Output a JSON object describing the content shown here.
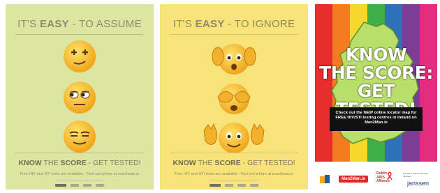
{
  "posters": [
    {
      "title_prefix": "IT'S",
      "title_bold": "EASY",
      "title_suffix": "- TO ASSUME",
      "emoji_icons": [
        "smirk-plus-eyes-emoji-icon",
        "side-eye-emoji-icon",
        "relieved-emoji-icon"
      ],
      "tagline_bold1": "KNOW",
      "tagline_mid": "THE",
      "tagline_bold2": "SCORE",
      "tagline_end": "- GET TESTED!",
      "info": "Free HIV and STI tests are available - Find out where at man2man.ie"
    },
    {
      "title_prefix": "IT'S",
      "title_bold": "EASY",
      "title_suffix": "- TO IGNORE",
      "emoji_icons": [
        "hear-no-evil-emoji-icon",
        "see-no-evil-emoji-icon",
        "speak-no-evil-emoji-icon"
      ],
      "tagline_bold1": "KNOW",
      "tagline_mid": "THE",
      "tagline_bold2": "SCORE",
      "tagline_end": "- GET TESTED!",
      "info": "Free HIV and STI tests are available - Find out where at man2man.ie"
    },
    {
      "headline": [
        "KNOW",
        "THE SCORE:",
        "GET TESTED!"
      ],
      "box_text": "Check out the NEW online locator map for FREE HIV/STI testing centres in Ireland on Man2Man.ie",
      "logos": {
        "man2man": "Man2Man.ie",
        "dublin_aids": "Dublin AIDS Alliance",
        "funded_by": "Funded in partnership with Janssen",
        "janssen": "janssen"
      }
    }
  ],
  "colors": {
    "poster1_bg": "#dde5a0",
    "poster2_bg": "#f8e27a",
    "rainbow": [
      "#e52d2d",
      "#f47c20",
      "#f6d82c",
      "#3dae49",
      "#2d71b8",
      "#7b3b96",
      "#e52d7d"
    ]
  }
}
